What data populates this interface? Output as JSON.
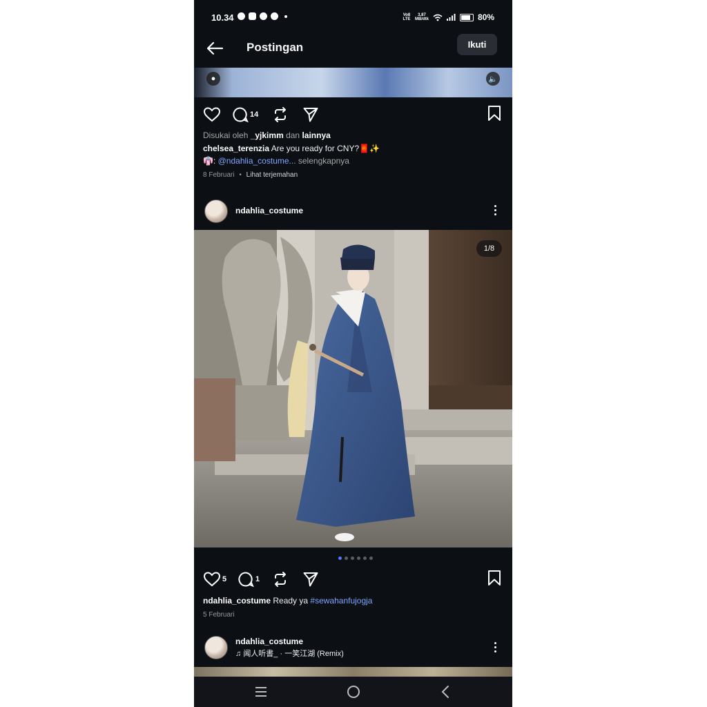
{
  "status_bar": {
    "time": "10.34",
    "network_line1": "Vo8 LTE",
    "speed_value": "3,87",
    "speed_unit": "MB/dtk",
    "battery": "80%"
  },
  "header": {
    "back_icon": "arrow-left-icon",
    "title": "Postingan",
    "follow_label": "Ikuti"
  },
  "post1": {
    "comment_count": "14",
    "liked_by_prefix": "Disukai oleh ",
    "liked_by_user": "_yjkimm",
    "liked_by_mid": " dan ",
    "liked_by_others": "lainnya",
    "author": "chelsea_terenzia",
    "caption_text": " Are you ready for CNY?",
    "caption_emojis": "🧧✨",
    "line2_emoji": "👘",
    "line2_colon": ": ",
    "mention": "@ndahlia_costume...",
    "more": " selengkapnya",
    "date": "8 Februari",
    "separator": "•",
    "translate": "Lihat terjemahan"
  },
  "post2": {
    "username": "ndahlia_costume",
    "image_counter": "1/8",
    "like_count": "5",
    "comment_count": "1",
    "author": "ndahlia_costume",
    "caption_text": " Ready ya ",
    "hashtag": "#sewahanfujogja",
    "date": "5 Februari",
    "pager": {
      "total": 6,
      "active": 0
    }
  },
  "post3": {
    "username": "ndahlia_costume",
    "music_icon": "music-note-icon",
    "music": "闻人听書_ · 一笑江湖 (Remix)"
  },
  "colors": {
    "background": "#0c0f14",
    "link": "#7fa6ff",
    "accent_dot": "#4b7bff"
  }
}
